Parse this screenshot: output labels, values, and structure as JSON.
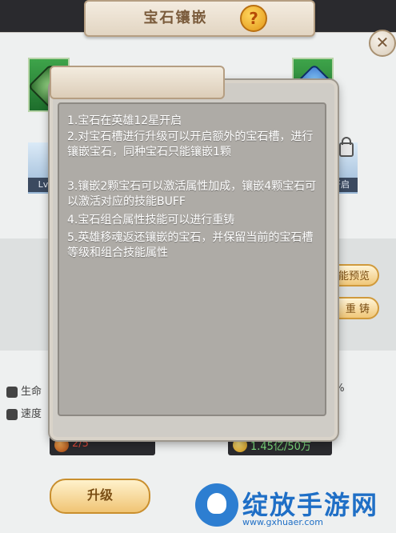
{
  "header": {
    "title": "宝石镶嵌",
    "help_symbol": "?",
    "close_symbol": "✕"
  },
  "slots": {
    "lv_label": "Lv",
    "open_label": "开启"
  },
  "side_buttons": {
    "preview_label": "能预览",
    "reforge_label": "重 铸"
  },
  "stats": {
    "hp_label": "生命",
    "speed_label": "速度",
    "percent": "1%"
  },
  "resources": {
    "left_value": "2/5",
    "right_value": "1.45亿/50万"
  },
  "actions": {
    "upgrade_label": "升级"
  },
  "popup": {
    "rules": [
      "1.宝石在英雄12星开启",
      "2.对宝石槽进行升级可以开启额外的宝石槽，进行镶嵌宝石，同种宝石只能镶嵌1颗",
      "3.镶嵌2颗宝石可以激活属性加成，镶嵌4颗宝石可以激活对应的技能BUFF",
      "4.宝石组合属性技能可以进行重铸",
      "5.英雄移魂返还镶嵌的宝石，并保留当前的宝石槽等级和组合技能属性"
    ]
  },
  "watermark": {
    "text": "绽放手游网",
    "url": "www.gxhuaer.com"
  },
  "colors": {
    "accent": "#f0c474",
    "resource_positive": "#7fe07f",
    "resource_negative": "#e04a3a"
  }
}
